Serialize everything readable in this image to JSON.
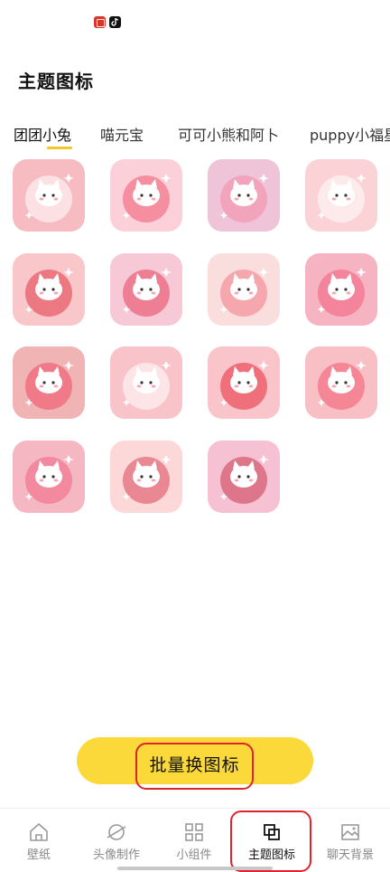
{
  "page": {
    "title": "主题图标"
  },
  "tabs": [
    {
      "label": "团团小兔",
      "active": true
    },
    {
      "label": "喵元宝",
      "active": false
    },
    {
      "label": "可可小熊和阿卜",
      "active": false
    },
    {
      "label": "puppy小福星",
      "active": false
    }
  ],
  "icons": [
    {
      "name": "icon-cat-in-box",
      "bg": "#f7bcc2",
      "accent": "#ffffff"
    },
    {
      "name": "icon-cat-on-heart",
      "bg": "#fbd0d8",
      "accent": "#f05a72"
    },
    {
      "name": "icon-cat-on-block",
      "bg": "#efc3d8",
      "accent": "#f48aa6"
    },
    {
      "name": "icon-cat-in-open-box",
      "bg": "#fbd3d6",
      "accent": "#ffffff"
    },
    {
      "name": "icon-cat-in-bowl",
      "bg": "#f9c6c9",
      "accent": "#e23b46"
    },
    {
      "name": "icon-cat-with-clock",
      "bg": "#f7c9d6",
      "accent": "#e8405c"
    },
    {
      "name": "icon-cat-on-card",
      "bg": "#fadedd",
      "accent": "#f27a86"
    },
    {
      "name": "icon-cats-on-gears",
      "bg": "#f6b4c2",
      "accent": "#f25c7c"
    },
    {
      "name": "icon-cat-with-cart",
      "bg": "#f1b4b4",
      "accent": "#f04a66"
    },
    {
      "name": "icon-cat-on-cloud",
      "bg": "#f8c3c9",
      "accent": "#ffffff"
    },
    {
      "name": "icon-cat-heart-glow",
      "bg": "#f9c5ca",
      "accent": "#e82a3a"
    },
    {
      "name": "icon-cat-on-photo",
      "bg": "#f8c0c4",
      "accent": "#f25570"
    },
    {
      "name": "icon-cat-with-camera",
      "bg": "#f5b7c2",
      "accent": "#f06484"
    },
    {
      "name": "icon-cat-with-book",
      "bg": "#fcd8d8",
      "accent": "#d8465a"
    },
    {
      "name": "icon-cat-with-music",
      "bg": "#f6c2d3",
      "accent": "#c8384e"
    }
  ],
  "batch_button": {
    "label": "批量换图标",
    "color": "#fbd93a"
  },
  "bottom_nav": [
    {
      "label": "壁纸",
      "icon": "home-icon",
      "active": false
    },
    {
      "label": "头像制作",
      "icon": "planet-icon",
      "active": false
    },
    {
      "label": "小组件",
      "icon": "grid-icon",
      "active": false
    },
    {
      "label": "主题图标",
      "icon": "layers-icon",
      "active": true
    },
    {
      "label": "聊天背景",
      "icon": "image-icon",
      "active": false
    }
  ],
  "colors": {
    "accent": "#f5c829",
    "highlight_box": "#e0222b"
  }
}
